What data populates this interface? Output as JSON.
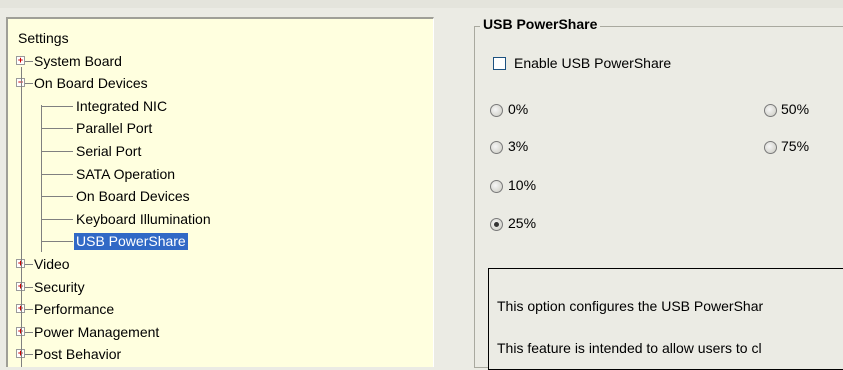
{
  "tree": {
    "root": "Settings",
    "items": [
      {
        "label": "System Board",
        "expander": "+"
      },
      {
        "label": "On Board Devices",
        "expander": "−"
      },
      {
        "label": "Integrated NIC"
      },
      {
        "label": "Parallel Port"
      },
      {
        "label": "Serial Port"
      },
      {
        "label": "SATA Operation"
      },
      {
        "label": "On Board Devices"
      },
      {
        "label": "Keyboard Illumination"
      },
      {
        "label": "USB PowerShare",
        "selected": true
      },
      {
        "label": "Video",
        "expander": "+"
      },
      {
        "label": "Security",
        "expander": "+"
      },
      {
        "label": "Performance",
        "expander": "+"
      },
      {
        "label": "Power Management",
        "expander": "+"
      },
      {
        "label": "Post Behavior",
        "expander": "+"
      }
    ]
  },
  "panel": {
    "title": "USB PowerShare",
    "enable_label": "Enable USB PowerShare",
    "enable_checked": false,
    "options": [
      {
        "label": "0%",
        "checked": false
      },
      {
        "label": "50%",
        "checked": false
      },
      {
        "label": "3%",
        "checked": false
      },
      {
        "label": "75%",
        "checked": false
      },
      {
        "label": "10%",
        "checked": false
      },
      {
        "label": "25%",
        "checked": true
      }
    ],
    "description": [
      "This option configures the USB PowerShar",
      "This feature is intended to allow users to cl"
    ]
  }
}
